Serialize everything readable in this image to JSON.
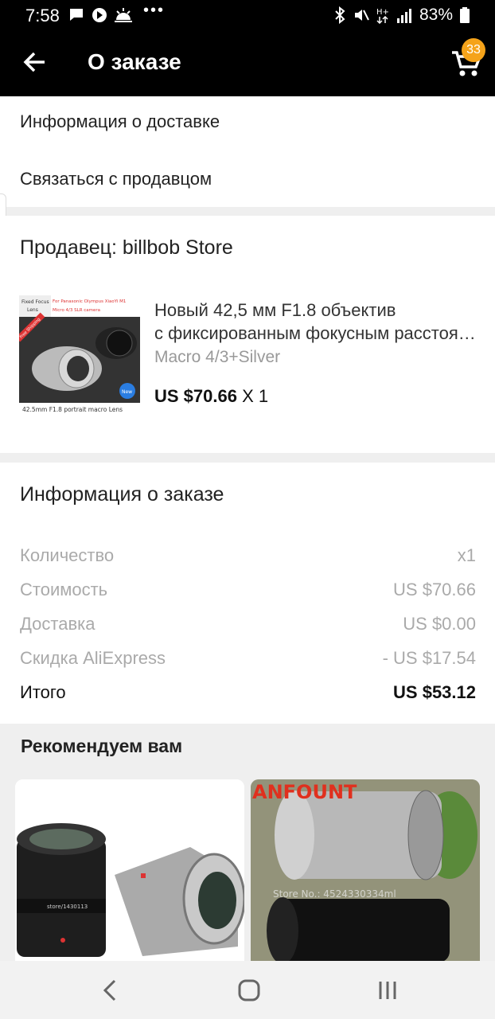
{
  "status": {
    "time": "7:58",
    "battery": "83%",
    "icons": [
      "message-icon",
      "youtube-icon",
      "weather-icon",
      "more-dots-icon",
      "bluetooth-icon",
      "mute-icon",
      "network-hplus-icon",
      "signal-icon",
      "battery-icon"
    ]
  },
  "header": {
    "title": "О заказе",
    "cart_count": "33"
  },
  "links": {
    "delivery_info": "Информация о доставке",
    "contact_seller": "Связаться с продавцом"
  },
  "seller": {
    "title": "Продавец: billbob Store"
  },
  "product": {
    "name_line1": "Новый 42,5 мм F1.8 объектив",
    "name_line2": "с фиксированным фокусным расстоянием",
    "variant": "Macro 4/3+Silver",
    "price": "US $70.66",
    "qty": "X 1",
    "thumb": {
      "tag1": "Fixed Focus",
      "tag2": "Lens",
      "line1": "For Panasonic Olympus XiaoYi M1",
      "line2": "Micro 4/3 SLR camera",
      "ribbon": "Free Shipping",
      "badge": "New",
      "caption": "42.5mm F1.8 portrait macro Lens"
    }
  },
  "order_info": {
    "title": "Информация о заказе",
    "rows": [
      {
        "label": "Количество",
        "value": "x1"
      },
      {
        "label": "Стоимость",
        "value": "US $70.66"
      },
      {
        "label": "Доставка",
        "value": "US $0.00"
      },
      {
        "label": "Скидка AliExpress",
        "value": "- US $17.54"
      }
    ],
    "total_label": "Итого",
    "total_value": "US $53.12"
  },
  "recommend": {
    "title": "Рекомендуем вам",
    "card1_lens_text": "store/1430113",
    "card2_brand": "ANFOUNT",
    "card2_watermark": "Store No.: 4524330334ml"
  },
  "colors": {
    "badge": "#f5a31a",
    "accent_red": "#e0301e"
  }
}
